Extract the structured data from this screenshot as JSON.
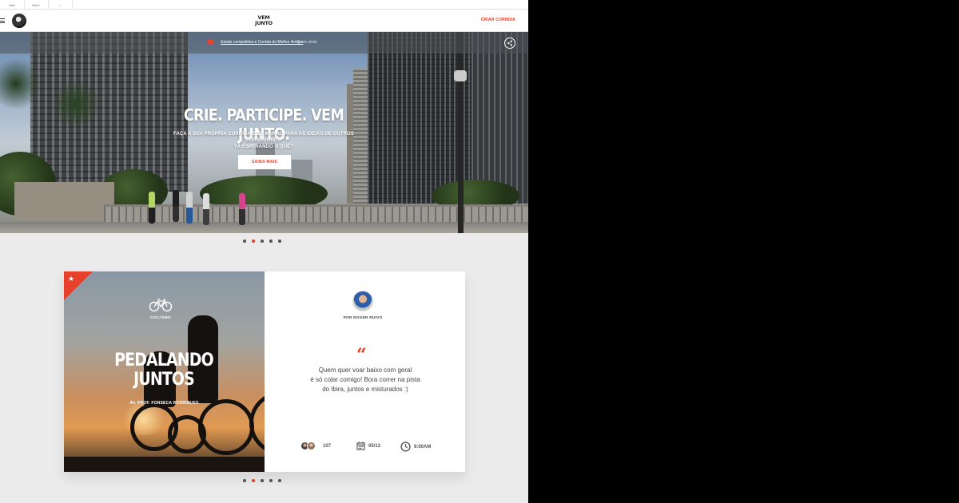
{
  "utility_bar": {
    "items": [
      "Nike",
      "Nike+",
      "⌂"
    ]
  },
  "header": {
    "menu_icon": "hamburger-icon",
    "logo_line1": "VEM",
    "logo_line2": "JUNTO",
    "create_label": "CRIAR CORRIDA"
  },
  "hero": {
    "notification": {
      "link_text": "Saúde competitiva e Corrida do Melhor Amigo.",
      "time": "2 min atrás"
    },
    "title": "CRIE. PARTICIPE. VEM JUNTO.",
    "subtitle_line1": "FAÇA A SUA PRÓPRIA CORRIDA E DÊ MURAL PARA AS IDEIAS DE OUTROS CORREDORES.",
    "subtitle_line2": "TÁ ESPERANDO O QUÊ?",
    "button_label": "SAIBA MAIS",
    "carousel": {
      "count": 5,
      "active_index": 1
    }
  },
  "event_card": {
    "category": "CICLISMO",
    "title_line1": "PEDALANDO",
    "title_line2": "JUNTOS",
    "organizer": "AV. PROF. FONSECA RODRIGUES",
    "author": "POR ROGER RUIVO",
    "quote_mark": "“",
    "quote_line1": "Quem quer voar baixo com geral",
    "quote_line2": "é só colar comigo! Bora correr na pista",
    "quote_line3": "do Ibira, juntos e misturados :)",
    "participants": "107",
    "date": "05/12",
    "time": "9:00AM",
    "carousel": {
      "count": 5,
      "active_index": 1
    }
  },
  "colors": {
    "accent": "#e8412b",
    "background": "#ebebeb"
  }
}
